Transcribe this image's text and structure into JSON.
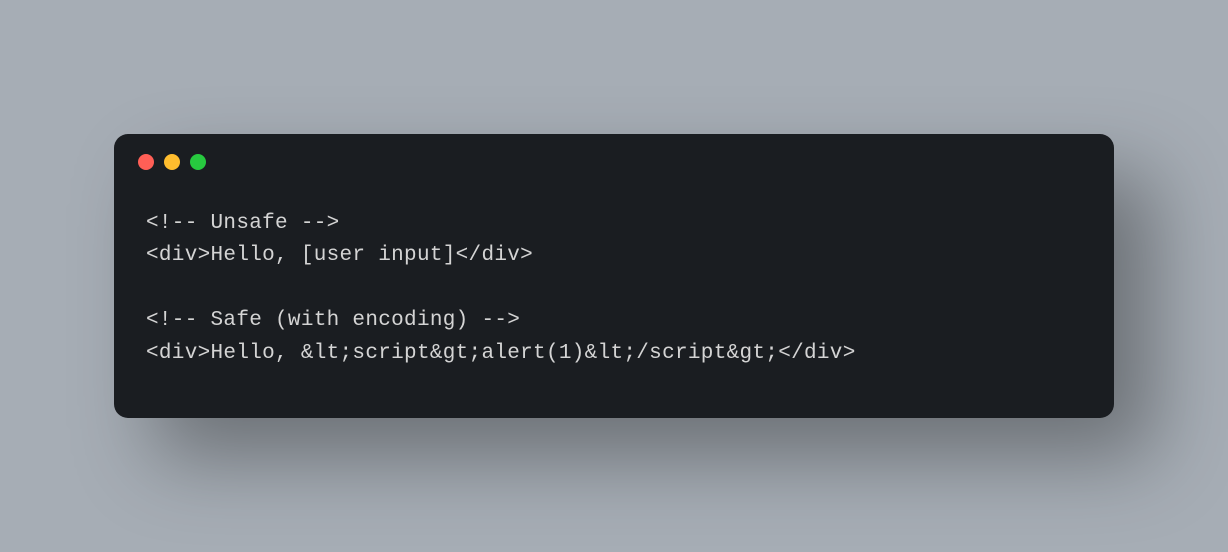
{
  "code": {
    "lines": [
      "<!-- Unsafe -->",
      "<div>Hello, [user input]</div>",
      "",
      "<!-- Safe (with encoding) -->",
      "<div>Hello, &lt;script&gt;alert(1)&lt;/script&gt;</div>"
    ]
  }
}
